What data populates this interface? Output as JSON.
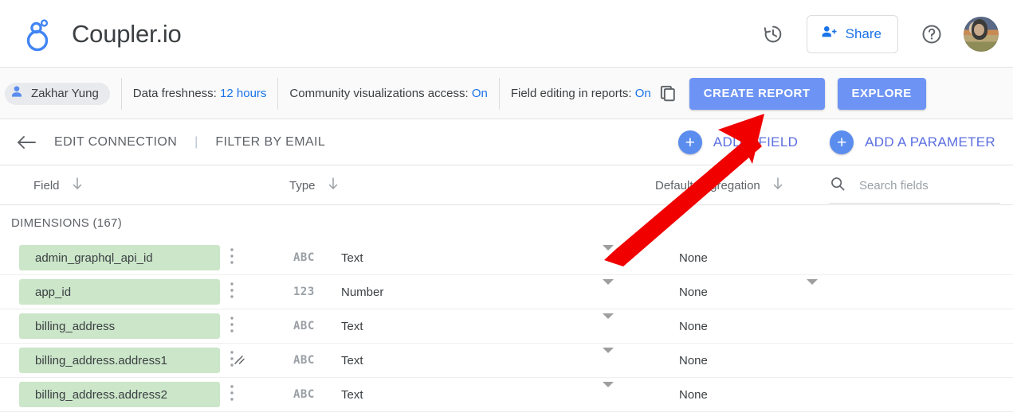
{
  "app": {
    "brand": "Coupler.io",
    "logo_icon": "coupler-logo-icon"
  },
  "topbar": {
    "history_icon": "history-restore-icon",
    "share_label": "Share",
    "share_icon": "person-add-icon",
    "help_icon": "help-question-icon",
    "avatar_icon": "user-avatar-photo"
  },
  "toolbar": {
    "user_chip": {
      "name": "Zakhar Yung",
      "icon": "person-icon"
    },
    "items": [
      {
        "label": "Data freshness:",
        "value": "12 hours"
      },
      {
        "label": "Community visualizations access:",
        "value": "On"
      },
      {
        "label": "Field editing in reports:",
        "value": "On"
      }
    ],
    "copy_icon": "copy-icon",
    "create_report_label": "CREATE REPORT",
    "explore_label": "EXPLORE",
    "button_color": "#6d94f5"
  },
  "navrow": {
    "back_icon": "back-arrow-icon",
    "edit_connection_label": "EDIT CONNECTION",
    "separator": "|",
    "filter_by_email_label": "FILTER BY EMAIL",
    "add_field_label": "ADD A FIELD",
    "add_parameter_label": "ADD A PARAMETER",
    "plus_icon": "plus-icon",
    "accent_color": "#5b8def"
  },
  "table": {
    "headers": [
      {
        "label": "Field",
        "sort_icon": "sort-down-arrow-icon"
      },
      {
        "label": "Type",
        "sort_icon": "sort-down-arrow-icon"
      },
      {
        "label": "Default Aggregation",
        "sort_icon": "sort-down-arrow-icon"
      }
    ],
    "search": {
      "placeholder": "Search fields",
      "value": "",
      "icon": "search-icon"
    },
    "resize_handle_icon": "column-resize-handle-icon",
    "section_label": "DIMENSIONS (167)",
    "pill_color": "#cbe6c9",
    "rows": [
      {
        "field": "admin_graphql_api_id",
        "type_icon": "ABC",
        "type": "Text",
        "aggregation": "None",
        "has_type_caret": true,
        "has_agg_caret": false
      },
      {
        "field": "app_id",
        "type_icon": "123",
        "type": "Number",
        "aggregation": "None",
        "has_type_caret": true,
        "has_agg_caret": true
      },
      {
        "field": "billing_address",
        "type_icon": "ABC",
        "type": "Text",
        "aggregation": "None",
        "has_type_caret": true,
        "has_agg_caret": false
      },
      {
        "field": "billing_address.address1",
        "type_icon": "ABC",
        "type": "Text",
        "aggregation": "None",
        "has_type_caret": true,
        "has_agg_caret": false
      },
      {
        "field": "billing_address.address2",
        "type_icon": "ABC",
        "type": "Text",
        "aggregation": "None",
        "has_type_caret": true,
        "has_agg_caret": false
      }
    ],
    "row_menu_icon": "more-vert-icon",
    "caret_icon": "dropdown-caret-icon"
  },
  "annotation": {
    "arrow_icon": "red-pointer-arrow",
    "color": "#f10000"
  }
}
